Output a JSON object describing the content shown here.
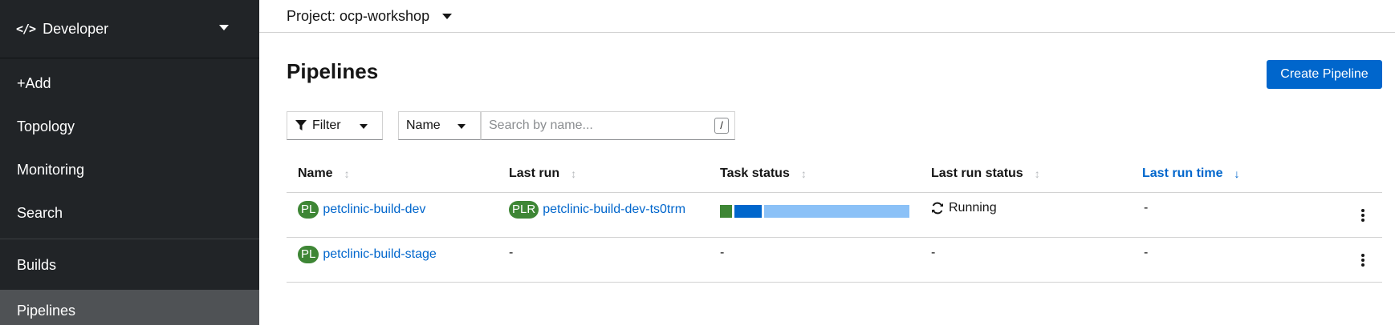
{
  "sidebar": {
    "perspective_icon": "</>",
    "perspective_label": "Developer",
    "items": [
      {
        "label": "+Add"
      },
      {
        "label": "Topology"
      },
      {
        "label": "Monitoring"
      },
      {
        "label": "Search"
      },
      {
        "label": "Builds"
      },
      {
        "label": "Pipelines"
      }
    ]
  },
  "project_bar": {
    "label": "Project: ocp-workshop"
  },
  "page": {
    "title": "Pipelines",
    "create_button": "Create Pipeline"
  },
  "toolbar": {
    "filter_label": "Filter",
    "attribute_label": "Name",
    "search_placeholder": "Search by name...",
    "search_shortcut": "/"
  },
  "table": {
    "columns": [
      "Name",
      "Last run",
      "Task status",
      "Last run status",
      "Last run time"
    ],
    "sorted_column": "Last run time",
    "rows": [
      {
        "badge": "PL",
        "name": "petclinic-build-dev",
        "last_run_badge": "PLR",
        "last_run": "petclinic-build-dev-ts0trm",
        "task_status": [
          {
            "state": "succeeded",
            "color": "#3e8635"
          },
          {
            "state": "running",
            "color": "#0066cc"
          },
          {
            "state": "pending",
            "color": "#8bc1f7"
          }
        ],
        "last_run_status": "Running",
        "last_run_time": "-"
      },
      {
        "badge": "PL",
        "name": "petclinic-build-stage",
        "last_run": "-",
        "task_status_text": "-",
        "last_run_status": "-",
        "last_run_time": "-"
      }
    ]
  },
  "colors": {
    "sidebar_bg": "#212427",
    "active_item_bg": "#4f5255",
    "primary": "#0066cc",
    "badge_green": "#3e8635"
  }
}
